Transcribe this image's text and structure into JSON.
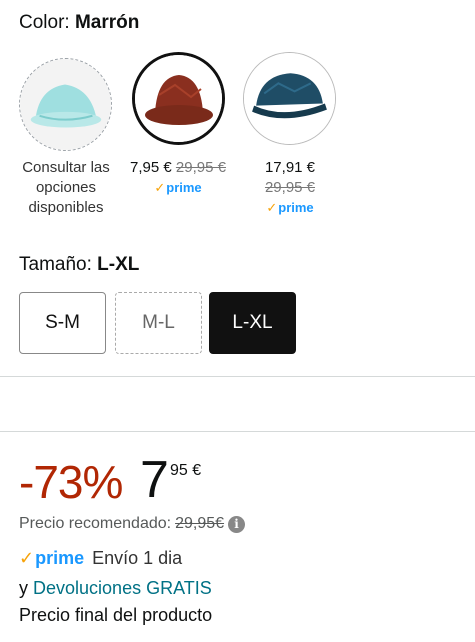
{
  "color": {
    "label": "Color:",
    "value": "Marrón"
  },
  "options": [
    {
      "name": "swatch-light-blue",
      "text": "Consultar las opciones disponibles"
    },
    {
      "name": "swatch-brown",
      "price": "7,95 €",
      "old_price": "29,95 €",
      "prime": "prime"
    },
    {
      "name": "swatch-navy-cap",
      "price": "17,91 €",
      "old_price": "29,95 €",
      "prime": "prime"
    }
  ],
  "size": {
    "label": "Tamaño:",
    "value": "L-XL",
    "options": [
      "S-M",
      "M-L",
      "L-XL"
    ]
  },
  "pricing": {
    "discount": "-73%",
    "price_whole": "7",
    "price_fraction": "95 €",
    "recommended_label": "Precio recomendado:",
    "recommended_price": "29,95€"
  },
  "shipping": {
    "prime": "prime",
    "text": "Envío 1 dia"
  },
  "returns": {
    "prefix": "y ",
    "link": "Devoluciones GRATIS"
  },
  "final_label": "Precio final del producto",
  "colors": {
    "accent_red": "#b12704",
    "prime_blue": "#1a98ff",
    "prime_check": "#f7a30a",
    "link": "#007185"
  }
}
